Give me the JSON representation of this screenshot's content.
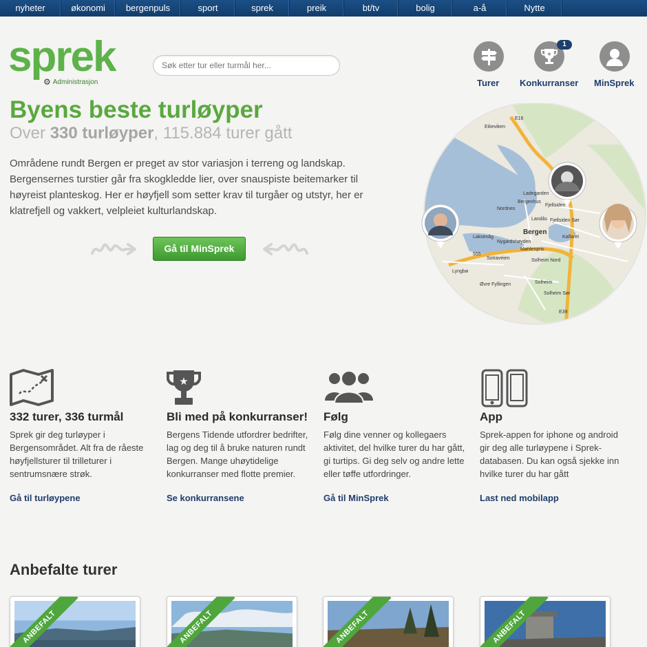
{
  "nav": [
    "nyheter",
    "økonomi",
    "bergenpuls",
    "sport",
    "sprek",
    "preik",
    "bt/tv",
    "bolig",
    "a-å",
    "Nytte"
  ],
  "logo": "sprek",
  "admin_label": "Administrasjon",
  "search_placeholder": "Søk etter tur eller turmål her...",
  "header_links": {
    "turer": "Turer",
    "konkurranser": "Konkurranser",
    "konkurranser_badge": "1",
    "minsprek": "MinSprek"
  },
  "hero": {
    "title": "Byens beste turløyper",
    "sub_prefix": "Over ",
    "sub_bold": "330 turløyper",
    "sub_suffix": ", 115.884 turer gått",
    "text": "Områdene rundt Bergen er preget av stor variasjon i terreng og landskap. Bergensernes turstier går fra skogkledde lier, over snauspiste beitemarker til høyreist planteskog. Her er høyfjell som setter krav til turgåer og utstyr, her er klatrefjell og vakkert, velpleiet kulturlandskap.",
    "cta": "Gå til MinSprek"
  },
  "map_labels": [
    "Eikeviken",
    "E16",
    "Ladegarden",
    "Bergenhus",
    "Fjellsiden",
    "Nordnes",
    "Landås",
    "Bergen",
    "Kalfaret",
    "Laksevåg",
    "Nygardshøyden",
    "Fjellsiden Sør",
    "Lyngbø",
    "Møhlenpris",
    "Solheim Nord",
    "Solheim",
    "Øvre Fyllingen",
    "Solheim Sør",
    "E39",
    "555",
    "Sotraveien"
  ],
  "features": [
    {
      "title": "332 turer, 336 turmål",
      "text": "Sprek gir deg turløyper i Bergensområdet. Alt fra de råeste høyfjellsturer til trilleturer i sentrumsnære strøk.",
      "link": "Gå til turløypene",
      "icon": "map-icon"
    },
    {
      "title": "Bli med på konkurranser!",
      "text": "Bergens Tidende utfordrer bedrifter, lag og deg til å bruke naturen rundt Bergen. Mange uhøytidelige konkurranser med flotte premier.",
      "link": "Se konkurransene",
      "icon": "trophy-icon"
    },
    {
      "title": "Følg",
      "text": "Følg dine venner og kollegaers aktivitet, del hvilke turer du har gått, gi turtips. Gi deg selv og andre lette eller tøffe utfordringer.",
      "link": "Gå til MinSprek",
      "icon": "people-icon"
    },
    {
      "title": "App",
      "text": "Sprek-appen for iphone og android gir deg alle turløypene i Sprek-databasen. Du kan også sjekke inn hvilke turer du har gått",
      "link": "Last ned mobilapp",
      "icon": "phones-icon"
    }
  ],
  "recommended": {
    "title": "Anbefalte turer",
    "ribbon": "ANBEFALT"
  },
  "colors": {
    "brand_green": "#5db24a",
    "nav_blue": "#1b4f86",
    "link_blue": "#1f3d6c"
  }
}
